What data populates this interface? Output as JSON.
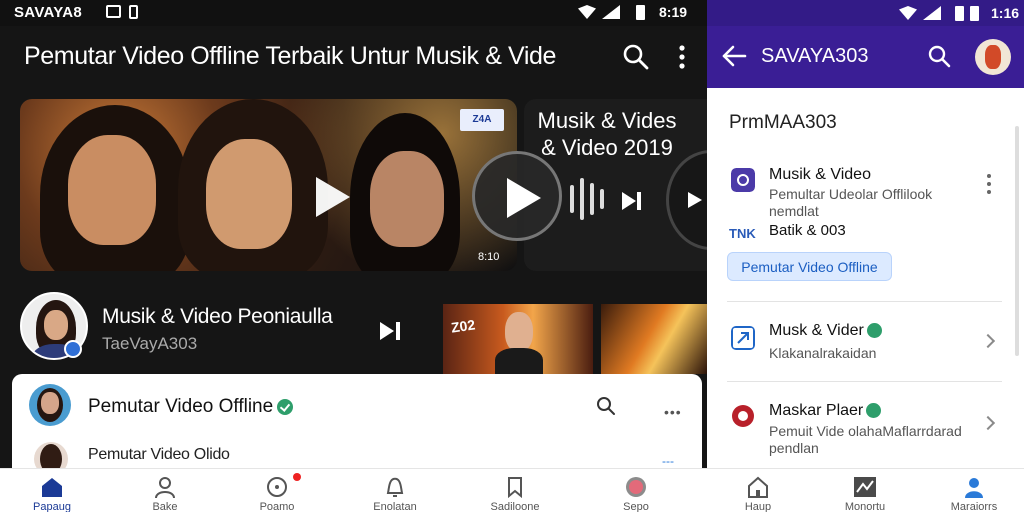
{
  "left": {
    "status": {
      "carrier": "SAVAYA8",
      "time": "8:19"
    },
    "appbar": {
      "title": "Pemutar Video Offline Terbaik Untur Musik & Vide"
    },
    "hero": {
      "tag": "Z4A",
      "duration": "8:10"
    },
    "card2": {
      "title": "Musik & Vides & Video 2019"
    },
    "channel": {
      "name": "Musik & Video Peoniaulla",
      "handle": "TaeVayA303"
    },
    "thumb1": {
      "text": "Z02"
    },
    "sheet": {
      "title": "Pemutar Video Offline",
      "row2": "Pemutar Video Olido",
      "more": "•••",
      "dots": "---"
    }
  },
  "right": {
    "status": {
      "time": "1:16"
    },
    "appbar": {
      "title": "SAVAYA303"
    },
    "header": "PrmMAA303",
    "items": [
      {
        "title": "Musik & Video",
        "sub1": "Pemultar Udeolar Offlilook",
        "sub2": "nemdlat",
        "tag": "TNK",
        "tagline": "Batik & 003",
        "pill": "Pemutar Video Offline"
      },
      {
        "title": "Musk & Vider",
        "sub1": "Klakanalrakaidan"
      },
      {
        "title": "Maskar Plaer",
        "sub1": "Pemuit Vide olahaMaflarrdarad",
        "sub2": "pendlan"
      }
    ]
  },
  "bottom_nav": [
    {
      "label": "Papaug",
      "icon": "home-icon"
    },
    {
      "label": "Bake",
      "icon": "person-icon"
    },
    {
      "label": "Poamo",
      "icon": "target-icon"
    },
    {
      "label": "Enolatan",
      "icon": "bell-icon"
    },
    {
      "label": "Sadiloone",
      "icon": "bookmark-icon"
    },
    {
      "label": "Sepo",
      "icon": "orb-icon"
    },
    {
      "label": "Haup",
      "icon": "house-icon"
    },
    {
      "label": "Monortu",
      "icon": "image-icon"
    },
    {
      "label": "Maraiorrs",
      "icon": "user-icon"
    }
  ],
  "colors": {
    "accent": "#3a1e95",
    "active_nav": "#1b3a96",
    "verified": "#2e9e6b",
    "badge_red": "#e22222"
  }
}
